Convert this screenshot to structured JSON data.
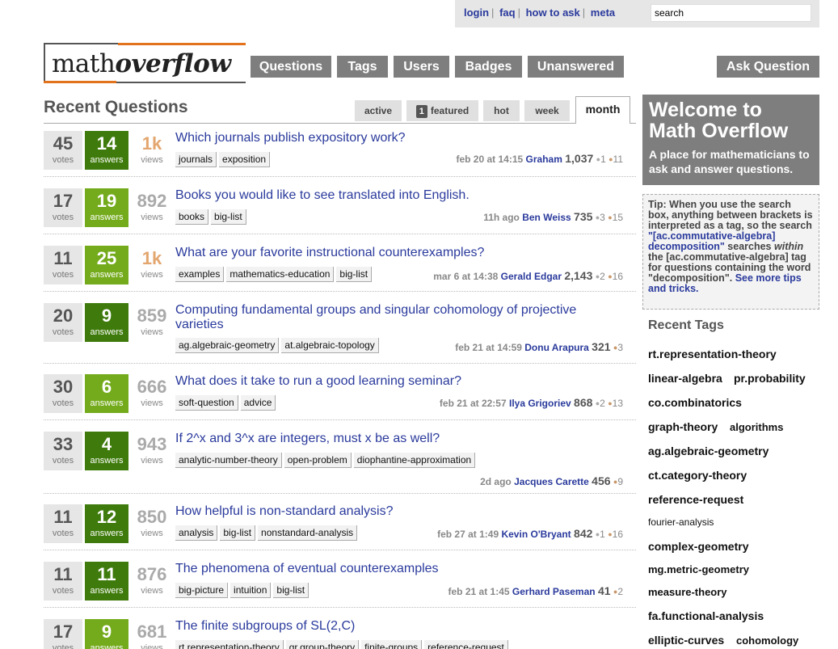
{
  "toplinks": [
    "login",
    "faq",
    "how to ask",
    "meta"
  ],
  "search": {
    "value": "search"
  },
  "logo": {
    "part1": "math",
    "part2": "overflow"
  },
  "nav": [
    "Questions",
    "Tags",
    "Users",
    "Badges",
    "Unanswered"
  ],
  "ask_button": "Ask Question",
  "recent_title": "Recent Questions",
  "tabs": {
    "active": "active",
    "featured": "featured",
    "featured_count": "1",
    "hot": "hot",
    "week": "week",
    "month": "month"
  },
  "questions": [
    {
      "votes": "45",
      "answers": "14",
      "views": "1k",
      "title": "Which journals publish expository work?",
      "tags": [
        "journals",
        "exposition"
      ],
      "when": "feb 20 at 14:15",
      "user": "Graham",
      "rep": "1,037",
      "silver": "1",
      "bronze": "11"
    },
    {
      "votes": "17",
      "answers": "19",
      "views": "892",
      "title": "Books you would like to see translated into English.",
      "tags": [
        "books",
        "big-list"
      ],
      "when": "11h ago",
      "user": "Ben Weiss",
      "rep": "735",
      "silver": "3",
      "bronze": "15"
    },
    {
      "votes": "11",
      "answers": "25",
      "views": "1k",
      "title": "What are your favorite instructional counterexamples?",
      "tags": [
        "examples",
        "mathematics-education",
        "big-list"
      ],
      "when": "mar 6 at 14:38",
      "user": "Gerald Edgar",
      "rep": "2,143",
      "silver": "2",
      "bronze": "16"
    },
    {
      "votes": "20",
      "answers": "9",
      "views": "859",
      "title": "Computing fundamental groups and singular cohomology of projective varieties",
      "tags": [
        "ag.algebraic-geometry",
        "at.algebraic-topology"
      ],
      "when": "feb 21 at 14:59",
      "user": "Donu Arapura",
      "rep": "321",
      "silver": "",
      "bronze": "3"
    },
    {
      "votes": "30",
      "answers": "6",
      "views": "666",
      "title": "What does it take to run a good learning seminar?",
      "tags": [
        "soft-question",
        "advice"
      ],
      "when": "feb 21 at 22:57",
      "user": "Ilya Grigoriev",
      "rep": "868",
      "silver": "2",
      "bronze": "13"
    },
    {
      "votes": "33",
      "answers": "4",
      "views": "943",
      "title": "If 2^x and 3^x are integers, must x be as well?",
      "tags": [
        "analytic-number-theory",
        "open-problem",
        "diophantine-approximation"
      ],
      "when": "2d ago",
      "user": "Jacques Carette",
      "rep": "456",
      "silver": "",
      "bronze": "9"
    },
    {
      "votes": "11",
      "answers": "12",
      "views": "850",
      "title": "How helpful is non-standard analysis?",
      "tags": [
        "analysis",
        "big-list",
        "nonstandard-analysis"
      ],
      "when": "feb 27 at 1:49",
      "user": "Kevin O'Bryant",
      "rep": "842",
      "silver": "1",
      "bronze": "16"
    },
    {
      "votes": "11",
      "answers": "11",
      "views": "876",
      "title": "The phenomena of eventual counterexamples",
      "tags": [
        "big-picture",
        "intuition",
        "big-list"
      ],
      "when": "feb 21 at 1:45",
      "user": "Gerhard Paseman",
      "rep": "41",
      "silver": "",
      "bronze": "2"
    },
    {
      "votes": "17",
      "answers": "9",
      "views": "681",
      "title": "The finite subgroups of SL(2,C)",
      "tags": [
        "rt.representation-theory",
        "gr.group-theory",
        "finite-groups",
        "reference-request"
      ],
      "when": "",
      "user": "",
      "rep": "",
      "silver": "",
      "bronze": ""
    }
  ],
  "labels": {
    "votes": "votes",
    "answers": "answers",
    "views": "views"
  },
  "welcome": {
    "title": "Welcome to Math Overflow",
    "text": "A place for mathematicians to ask and answer questions."
  },
  "tip": {
    "t1": "Tip: When you use the search box, anything between brackets is interpreted as a tag, so the search ",
    "t2": "\"[ac.commutative-algebra] decomposition\"",
    "t3": " searches ",
    "t4": "within",
    "t5": " the [ac.commutative-algebra] tag for questions containing the word \"decomposition\". ",
    "t6": "See more tips and tricks."
  },
  "recent_tags_title": "Recent Tags",
  "recent_tags": [
    "rt.representation-theory",
    "linear-algebra",
    "pr.probability",
    "co.combinatorics",
    "graph-theory",
    "algorithms",
    "ag.algebraic-geometry",
    "ct.category-theory",
    "reference-request",
    "fourier-analysis",
    "complex-geometry",
    "mg.metric-geometry",
    "measure-theory",
    "fa.functional-analysis",
    "elliptic-curves",
    "cohomology"
  ],
  "colors": {
    "accent": "#e3721d",
    "link": "#2a3a9c",
    "answers_dark": "#3f7b0c",
    "answers_light": "#74ab1c",
    "nav_bg": "#7e7e7e"
  }
}
